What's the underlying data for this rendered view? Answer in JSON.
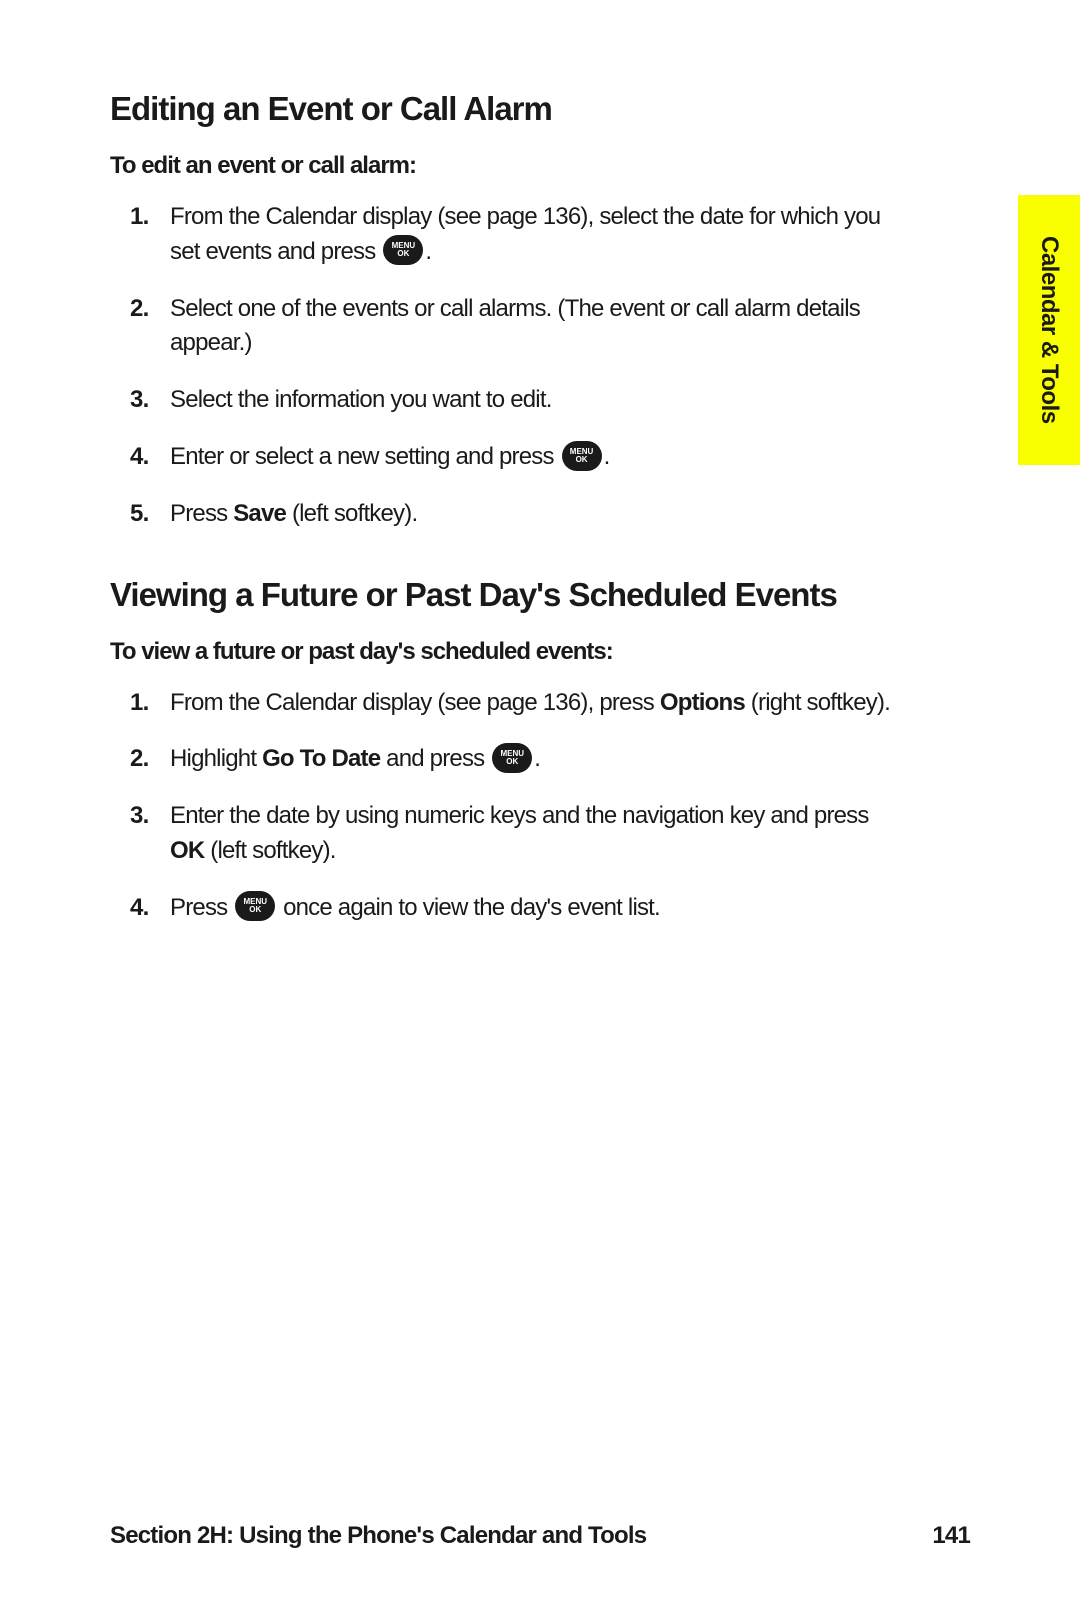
{
  "sideTab": "Calendar & Tools",
  "section1": {
    "heading": "Editing an Event or Call Alarm",
    "sub": "To edit an event or call alarm:",
    "steps": {
      "s1a": "From the Calendar display (see page 136), select the date for which you set events and press ",
      "s1b": ".",
      "s2": "Select one of the events or call alarms. (The event or call alarm details appear.)",
      "s3": "Select the information you want to edit.",
      "s4a": "Enter or select a new setting and press ",
      "s4b": ".",
      "s5a": "Press ",
      "s5bold": "Save",
      "s5b": " (left softkey)."
    }
  },
  "section2": {
    "heading": "Viewing a Future or Past Day's Scheduled Events",
    "sub": "To view a future or past day's scheduled events:",
    "steps": {
      "s1a": "From the Calendar display (see page 136), press ",
      "s1bold": "Options",
      "s1b": " (right softkey).",
      "s2a": "Highlight ",
      "s2bold": "Go To Date",
      "s2b": " and press ",
      "s2c": ".",
      "s3a": "Enter the date by using numeric keys and the navigation key and press ",
      "s3bold": "OK",
      "s3b": " (left softkey).",
      "s4a": "Press ",
      "s4b": " once again to view the day's event list."
    }
  },
  "iconTop": "MENU",
  "iconBottom": "OK",
  "footer": {
    "section": "Section 2H: Using the Phone's Calendar and Tools",
    "page": "141"
  }
}
